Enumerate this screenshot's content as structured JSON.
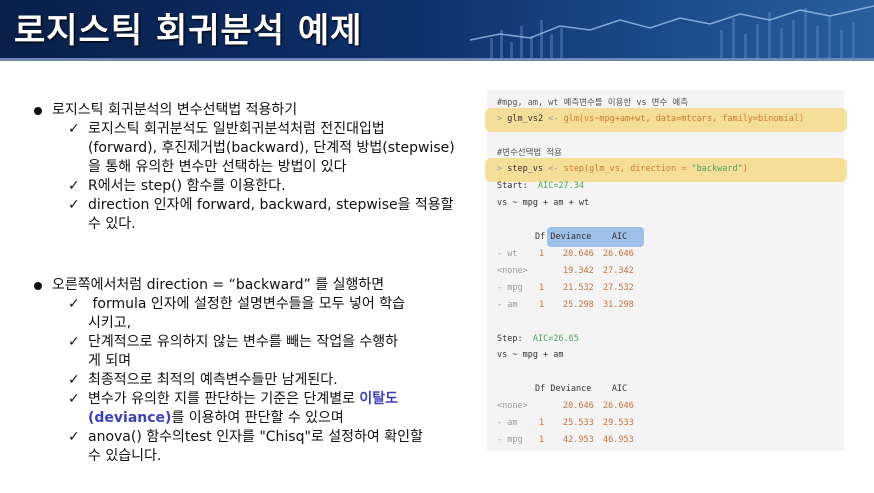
{
  "header": {
    "title": "로지스틱 회귀분석 예제"
  },
  "left": {
    "section1": {
      "bullet": "로지스틱 회귀분석의 변수선택법 적용하기",
      "checks": [
        [
          "로지스틱 회귀분석도 일반회귀분석처럼 전진대입법",
          "(forward), 후진제거법(backward), 단계적 방법(stepwise)",
          "을 통해 유의한 변수만 선택하는 방법이 있다"
        ],
        [
          "R에서는 step() 함수를 이용한다."
        ],
        [
          "direction 인자에 forward, backward, stepwise을 적용할",
          "수 있다."
        ]
      ]
    },
    "section2": {
      "bullet": "오른쪽에서처럼 direction = “backward” 를 실행하면",
      "checks": [
        [
          " formula 인자에 설정한 설명변수들을 모두 넣어 학습",
          "시키고,"
        ],
        [
          "단계적으로 유의하지 않는 변수를 빼는 작업을 수행하",
          "게 되며"
        ],
        [
          "최종적으로 최적의 예측변수들만 남게된다."
        ],
        [
          "anova() 함수의test 인자를 \"Chisq\"로 설정하여 확인할",
          "수 있습니다."
        ]
      ],
      "deviance_check": {
        "pre": "변수가 유의한 지를 판단하는 기준은 단계별로 ",
        "hl1": "이탈도",
        "hl2": "(deviance)",
        "post": "를 이용하여 판단할 수 있으며"
      }
    }
  },
  "code": {
    "comment1": "#mpg, am, wt 예측변수를 이용한 vs 변수 예측",
    "cmd1": {
      "prompt": ">",
      "obj": "glm_vs2",
      "arrow": "<-",
      "call": "glm(vs~mpg+am+wt, data=mtcars, family=binomial)"
    },
    "comment2": "#변수선택법 적용",
    "cmd2": {
      "prompt": ">",
      "obj": "step_vs",
      "arrow": "<-",
      "fn": "step(glm_vs, direction = ",
      "arg": "\"backward\"",
      "close": ")"
    },
    "start": {
      "label": "Start:",
      "aic": "AIC=27.34"
    },
    "formula1": "vs ~ mpg + am + wt",
    "table1": {
      "header": {
        "df": "Df",
        "dev": "Deviance",
        "aic": "AIC"
      },
      "rows": [
        {
          "term": "- wt",
          "df": "1",
          "dev": "20.646",
          "aic": "26.646"
        },
        {
          "term": "<none>",
          "df": "",
          "dev": "19.342",
          "aic": "27.342"
        },
        {
          "term": "- mpg",
          "df": "1",
          "dev": "21.532",
          "aic": "27.532"
        },
        {
          "term": "- am",
          "df": "1",
          "dev": "25.298",
          "aic": "31.298"
        }
      ]
    },
    "step": {
      "label": "Step:",
      "aic": "AIC=26.65"
    },
    "formula2": "vs ~ mpg + am",
    "table2": {
      "header": {
        "df": "Df",
        "dev": "Deviance",
        "aic": "AIC"
      },
      "rows": [
        {
          "term": "<none>",
          "df": "",
          "dev": "20.646",
          "aic": "26.646"
        },
        {
          "term": "- am",
          "df": "1",
          "dev": "25.533",
          "aic": "29.533"
        },
        {
          "term": "- mpg",
          "df": "1",
          "dev": "42.953",
          "aic": "46.953"
        }
      ]
    }
  }
}
